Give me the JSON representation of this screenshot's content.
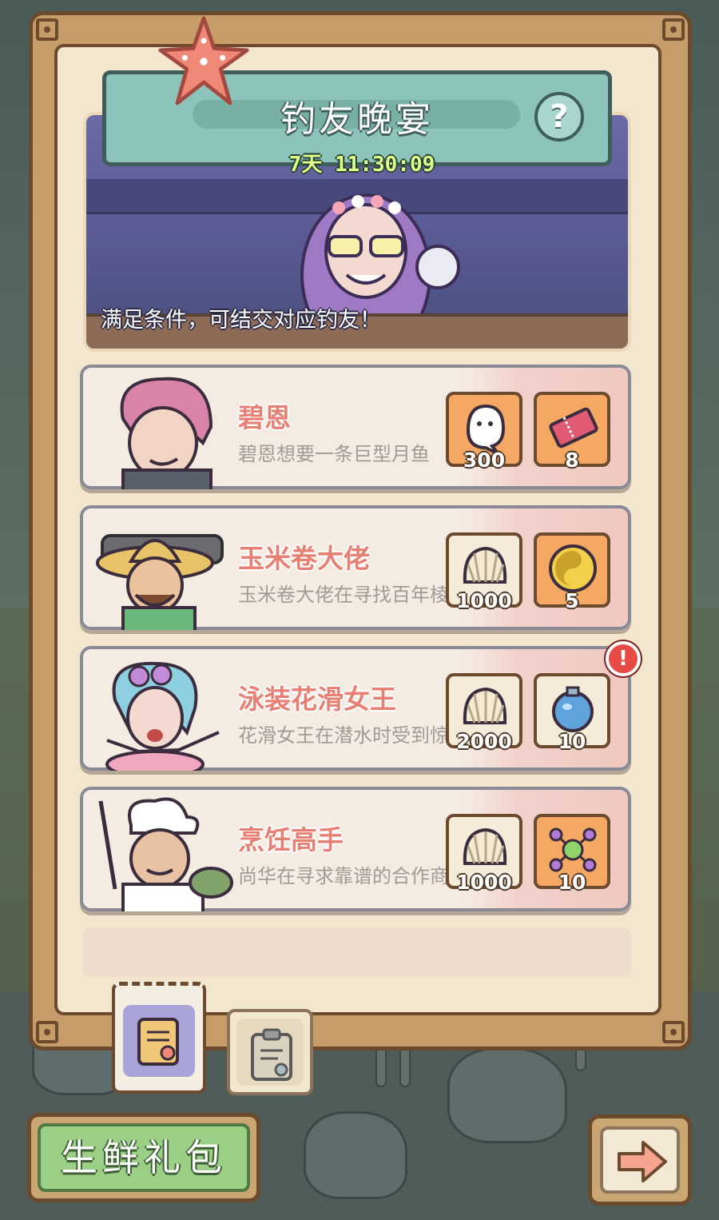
{
  "event": {
    "title": "钓友晚宴",
    "timer": "7天 11:30:09",
    "help_glyph": "?",
    "banner_text": "满足条件，可结交对应钓友！"
  },
  "quests": [
    {
      "name": "碧恩",
      "desc": "碧恩想要一条巨型月鱼",
      "portrait": "pink-hair-man-portrait",
      "rewards": [
        {
          "icon": "ghost-icon",
          "count": "300",
          "style": "orange"
        },
        {
          "icon": "ticket-icon",
          "count": "8",
          "style": "orange"
        }
      ],
      "alert": false
    },
    {
      "name": "玉米卷大佬",
      "desc": "玉米卷大佬在寻找百年棱皮龟",
      "portrait": "sombrero-man-portrait",
      "rewards": [
        {
          "icon": "shell-icon",
          "count": "1000",
          "style": "neutral"
        },
        {
          "icon": "yin-yang-coin-icon",
          "count": "5",
          "style": "orange"
        }
      ],
      "alert": false
    },
    {
      "name": "泳装花滑女王",
      "desc": "花滑女王在潜水时受到惊吓",
      "portrait": "skater-queen-portrait",
      "rewards": [
        {
          "icon": "shell-icon",
          "count": "2000",
          "style": "neutral"
        },
        {
          "icon": "bottle-orb-icon",
          "count": "10",
          "style": "orange"
        }
      ],
      "alert": true,
      "alert_glyph": "!"
    },
    {
      "name": "烹饪高手",
      "desc": "尚华在寻求靠谱的合作商",
      "portrait": "chef-portrait",
      "rewards": [
        {
          "icon": "shell-icon",
          "count": "1000",
          "style": "neutral"
        },
        {
          "icon": "molecule-icon",
          "count": "10",
          "style": "orange"
        }
      ],
      "alert": false
    }
  ],
  "tabs": [
    {
      "icon": "quest-scroll-icon",
      "active": true
    },
    {
      "icon": "clipboard-icon",
      "active": false
    }
  ],
  "buttons": {
    "gift_label": "生鲜礼包",
    "next_icon": "arrow-right-icon"
  },
  "colors": {
    "frame": "#6b4a2e",
    "header": "#8cc4bb",
    "quest_name": "#e87f73",
    "reward_bg": "#f5a863",
    "alert": "#e64b45",
    "gift_button": "#9ccf86"
  }
}
